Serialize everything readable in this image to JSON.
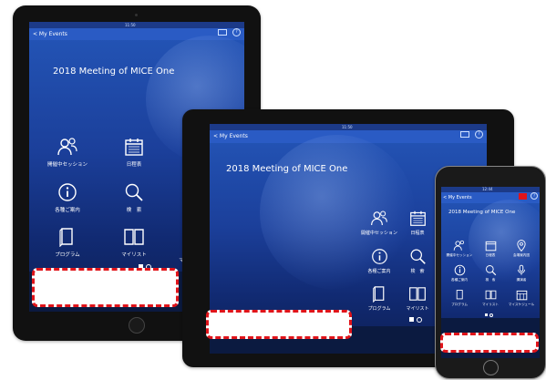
{
  "app": {
    "back_label": "< My Events",
    "event_title": "2018 Meeting of MICE One",
    "help_glyph": "?",
    "status_time": "11:50",
    "status_time_phone": "12:44",
    "colors": {
      "accent": "#2a5bc4",
      "highlight": "#e0141a"
    }
  },
  "menu": {
    "session": "開催中セッション",
    "schedule": "日程表",
    "venue": "会場案内図",
    "info": "各種ご案内",
    "search": "検　索",
    "speaker": "講演者",
    "program": "プログラム",
    "mylist": "マイリスト",
    "truncated": "マ",
    "my_schedule": "マイスケジュール"
  },
  "pager": {
    "current": 1,
    "total": 2
  }
}
